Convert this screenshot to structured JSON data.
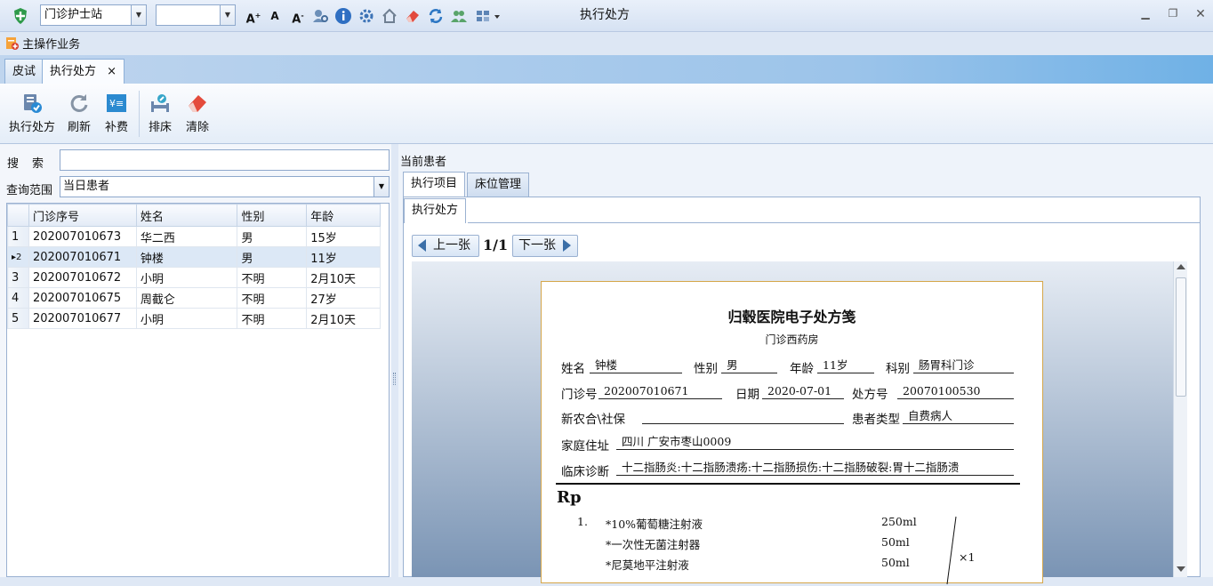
{
  "titlebar": {
    "station": "门诊护士站",
    "second_combo": "",
    "window_title": "执行处方",
    "icons": [
      "app-shield-icon",
      "font-increase-icon",
      "font-normal-icon",
      "font-decrease-icon",
      "settings-people-icon",
      "info-icon",
      "gear-icon",
      "home-icon",
      "eraser-icon",
      "refresh-icon",
      "users-icon",
      "layout-icon"
    ]
  },
  "menubar": {
    "main_business": "主操作业务"
  },
  "doc_tabs": [
    {
      "label": "皮试"
    },
    {
      "label": "执行处方",
      "close": "×"
    }
  ],
  "ribbon": {
    "execute": "执行处方",
    "refresh": "刷新",
    "supplement": "补费",
    "bed": "排床",
    "clear": "清除"
  },
  "left": {
    "search_label": "搜　索",
    "search_value": "",
    "range_label": "查询范围",
    "range_value": "当日患者",
    "columns": [
      "门诊序号",
      "姓名",
      "性别",
      "年龄"
    ],
    "rows": [
      {
        "n": "1",
        "id": "202007010673",
        "name": "华二西",
        "sex": "男",
        "age": "15岁"
      },
      {
        "n": "▸2",
        "id": "202007010671",
        "name": "钟楼",
        "sex": "男",
        "age": "11岁"
      },
      {
        "n": "3",
        "id": "202007010672",
        "name": "小明",
        "sex": "不明",
        "age": "2月10天"
      },
      {
        "n": "4",
        "id": "202007010675",
        "name": "周截仑",
        "sex": "不明",
        "age": "27岁"
      },
      {
        "n": "5",
        "id": "202007010677",
        "name": "小明",
        "sex": "不明",
        "age": "2月10天"
      }
    ]
  },
  "right": {
    "current_patient_label": "当前患者",
    "tabs": [
      "执行项目",
      "床位管理"
    ],
    "subtab": "执行处方",
    "prev": "上一张",
    "page": "1/1",
    "next": "下一张"
  },
  "prescription": {
    "title": "归毂医院电子处方笺",
    "pharmacy": "门诊西药房",
    "name_label": "姓名",
    "name": "钟楼",
    "sex_label": "性别",
    "sex": "男",
    "age_label": "年龄",
    "age": "11岁",
    "dept_label": "科别",
    "dept": "肠胃科门诊",
    "clinic_no_label": "门诊号",
    "clinic_no": "202007010671",
    "date_label": "日期",
    "date": "2020-07-01",
    "rx_no_label": "处方号",
    "rx_no": "20070100530",
    "insurance_label": "新农合\\社保",
    "insurance": "",
    "ptype_label": "患者类型",
    "ptype": "自费病人",
    "address_label": "家庭住址",
    "address": "四川 广安市枣山0009",
    "diagnosis_label": "临床诊断",
    "diagnosis": "十二指肠炎:十二指肠溃疡:十二指肠损伤:十二指肠破裂:胃十二指肠溃",
    "rp": "Rp",
    "group_no": "1.",
    "drugs": [
      {
        "name": "*10%葡萄糖注射液",
        "qty": "250ml"
      },
      {
        "name": "*一次性无菌注射器",
        "qty": "50ml"
      },
      {
        "name": "*尼莫地平注射液",
        "qty": "50ml"
      }
    ],
    "times": "×1"
  }
}
